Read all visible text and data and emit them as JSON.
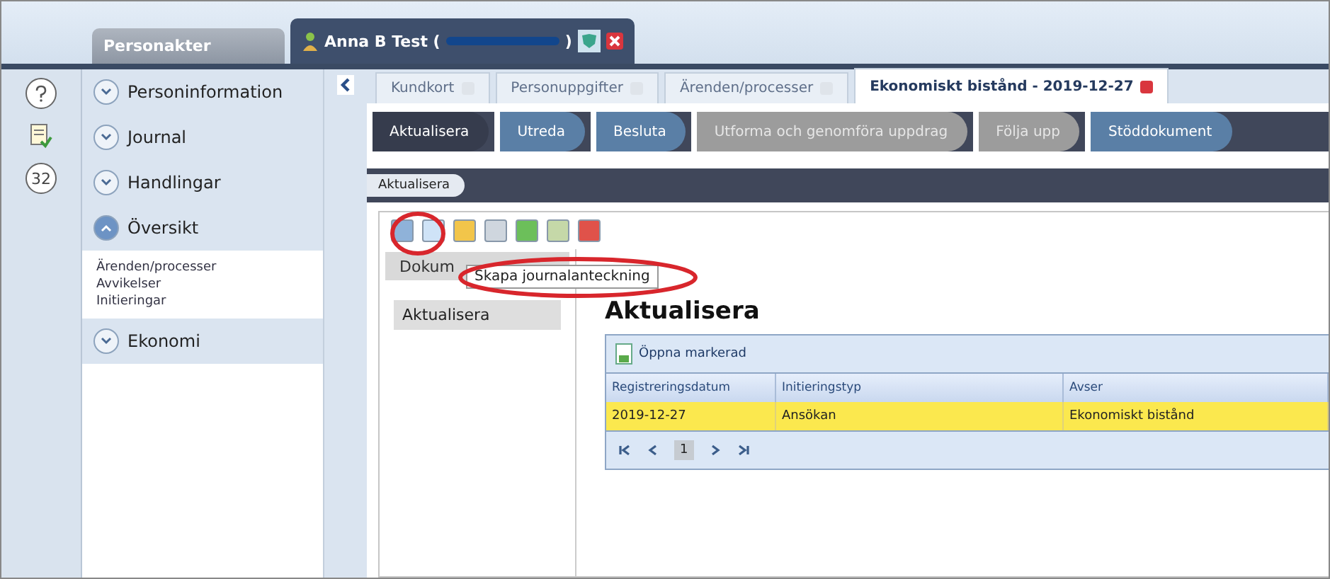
{
  "rail": {
    "badge": "32"
  },
  "top_tabs": [
    {
      "label": "Personakter",
      "selected": false
    },
    {
      "label_prefix": "Anna B Test (",
      "label_suffix": ")",
      "selected": true
    }
  ],
  "sidebar": {
    "sections": [
      {
        "label": "Personinformation",
        "expanded": false
      },
      {
        "label": "Journal",
        "expanded": false
      },
      {
        "label": "Handlingar",
        "expanded": false
      },
      {
        "label": "Översikt",
        "expanded": true,
        "children": [
          "Ärenden/processer",
          "Avvikelser",
          "Initieringar"
        ]
      },
      {
        "label": "Ekonomi",
        "expanded": false
      }
    ]
  },
  "doc_tabs": [
    {
      "label": "Kundkort",
      "selected": false
    },
    {
      "label": "Personuppgifter",
      "selected": false
    },
    {
      "label": "Ärenden/processer",
      "selected": false
    },
    {
      "label": "Ekonomiskt bistånd - 2019-12-27",
      "selected": true
    }
  ],
  "steps": [
    {
      "label": "Aktualisera",
      "selected": true,
      "disabled": false
    },
    {
      "label": "Utreda",
      "selected": false,
      "disabled": false
    },
    {
      "label": "Besluta",
      "selected": false,
      "disabled": false
    },
    {
      "label": "Utforma och genomföra uppdrag",
      "selected": false,
      "disabled": true
    },
    {
      "label": "Följa upp",
      "selected": false,
      "disabled": true
    },
    {
      "label": "Stöddokument",
      "selected": false,
      "disabled": false
    }
  ],
  "substep": "Aktualisera",
  "tooltip": "Skapa journalanteckning",
  "left_panel": {
    "tab": "Dokum",
    "items": [
      {
        "label": "Aktualisera",
        "selected": true
      }
    ]
  },
  "heading": "Aktualisera",
  "grid": {
    "open_button": "Öppna markerad",
    "columns": [
      "Registreringsdatum",
      "Initieringstyp",
      "Avser"
    ],
    "rows": [
      {
        "cells": [
          "2019-12-27",
          "Ansökan",
          "Ekonomiskt bistånd"
        ],
        "selected": true
      }
    ],
    "page": "1"
  }
}
